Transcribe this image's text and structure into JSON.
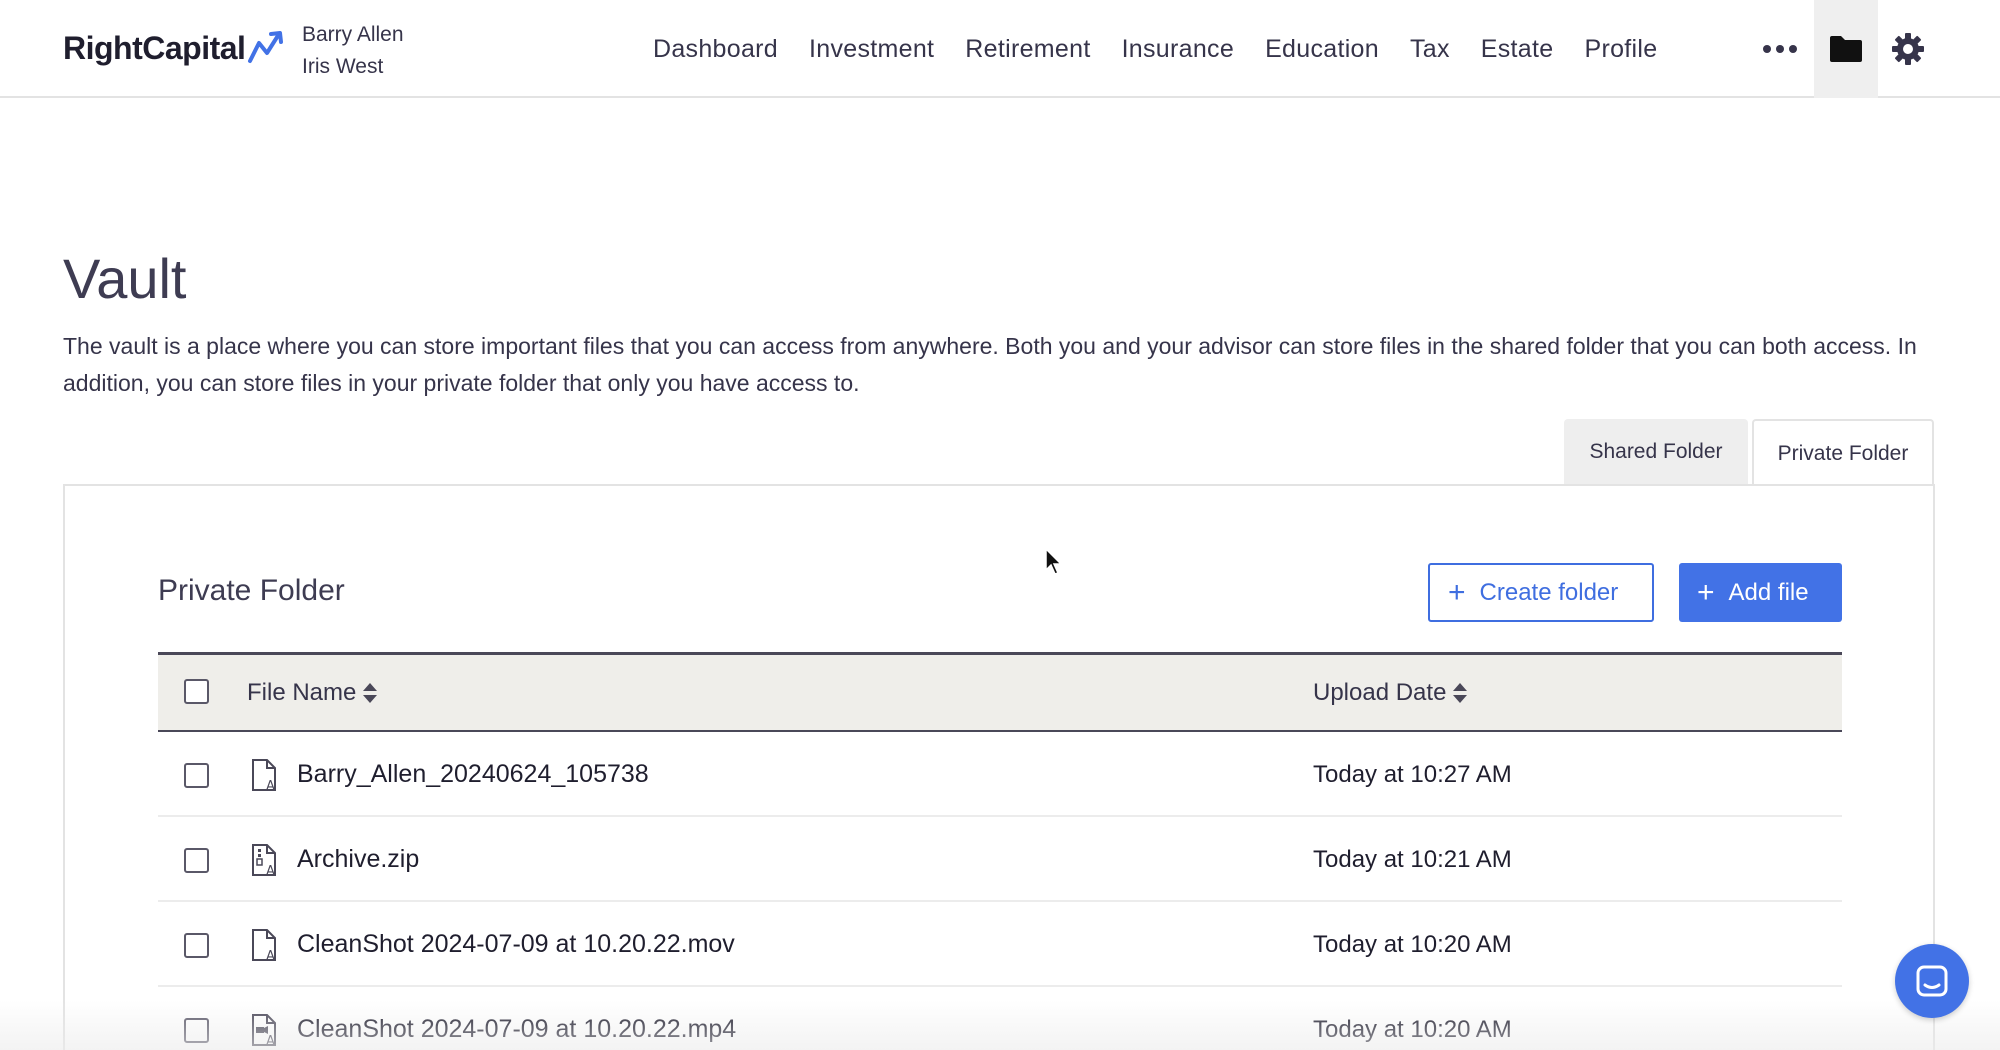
{
  "header": {
    "logo_text": "RightCapital",
    "clients": [
      "Barry Allen",
      "Iris West"
    ],
    "nav": [
      "Dashboard",
      "Investment",
      "Retirement",
      "Insurance",
      "Education",
      "Tax",
      "Estate",
      "Profile"
    ],
    "icons": {
      "more": "more-dots-icon",
      "vault": "folder-icon",
      "settings": "gear-icon"
    }
  },
  "page": {
    "title": "Vault",
    "description": "The vault is a place where you can store important files that you can access from anywhere. Both you and your advisor can store files in the shared folder that you can both access. In addition, you can store files in your private folder that only you have access to."
  },
  "tabs": [
    {
      "label": "Shared Folder",
      "active": false
    },
    {
      "label": "Private Folder",
      "active": true
    }
  ],
  "panel": {
    "title": "Private Folder",
    "create_folder_label": "Create folder",
    "add_file_label": "Add file"
  },
  "table": {
    "columns": {
      "name": "File Name",
      "date": "Upload Date"
    },
    "rows": [
      {
        "name": "Barry_Allen_20240624_105738",
        "date": "Today at 10:27 AM",
        "icon": "document-icon"
      },
      {
        "name": "Archive.zip",
        "date": "Today at 10:21 AM",
        "icon": "archive-file-icon"
      },
      {
        "name": "CleanShot 2024-07-09 at 10.20.22.mov",
        "date": "Today at 10:20 AM",
        "icon": "document-icon"
      },
      {
        "name": "CleanShot 2024-07-09 at 10.20.22.mp4",
        "date": "Today at 10:20 AM",
        "icon": "video-file-icon"
      }
    ]
  },
  "colors": {
    "accent": "#4272e6",
    "text": "#36344a",
    "header_bg": "#efeeea"
  }
}
